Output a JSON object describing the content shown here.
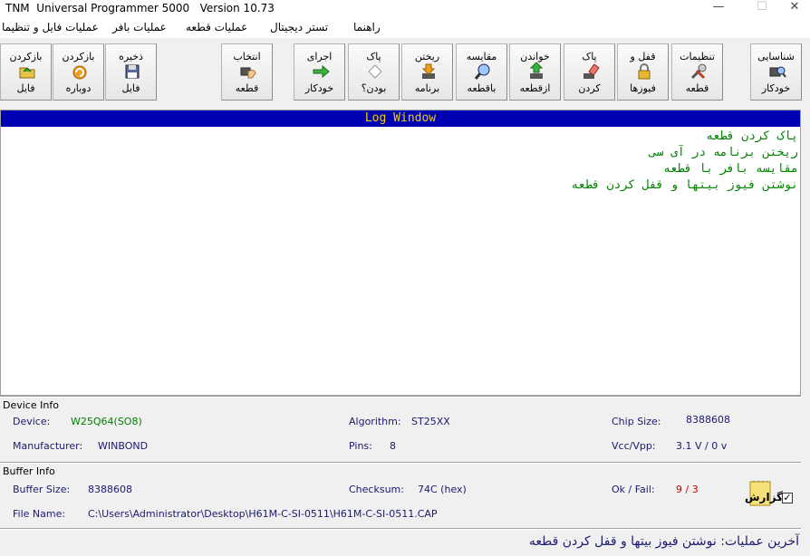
{
  "window": {
    "title": "TNM  Universal Programmer 5000   Version 10.73",
    "minimize": "—",
    "maximize": "☐",
    "close": "✕"
  },
  "menu": [
    "عملیات فایل و تنظیما",
    "عملیات بافر",
    "عملیات قطعه",
    "تستر دیجیتال",
    "راهنما"
  ],
  "toolbar": {
    "load_file": [
      "بازکردن",
      "فایل"
    ],
    "reload": [
      "بازکردن",
      "دوباره"
    ],
    "save_file": [
      "ذخیره",
      "فایل"
    ],
    "select_device": [
      "انتخاب",
      "قطعه"
    ],
    "auto_program": [
      "اجرای",
      "خودکار"
    ],
    "blank_check": [
      "پاک",
      "بودن؟"
    ],
    "program": [
      "ریختن",
      "برنامه"
    ],
    "verify": [
      "مقایسه",
      "باقطعه"
    ],
    "read": [
      "خواندن",
      "ازقطعه"
    ],
    "erase": [
      "پاک",
      "کردن"
    ],
    "lock_fuses": [
      "قفل و",
      "فیوزها"
    ],
    "device_settings": [
      "تنظیمات",
      "قطعه"
    ],
    "auto_detect": [
      "شناسایی",
      "خودکار"
    ]
  },
  "log": {
    "header": "Log Window",
    "lines": [
      "پاک کردن قطعه",
      "ریختن برنامه در آی سی",
      "مقایسه بافر با قطعه",
      "نوشتن فیوز بیتها و قفل کردن قطعه"
    ]
  },
  "device_info": {
    "group_title": "Device Info",
    "device_label": "Device:",
    "device_value": "W25Q64(SO8)",
    "algorithm_label": "Algorithm:",
    "algorithm_value": "ST25XX",
    "chip_size_label": "Chip Size:",
    "chip_size_value": "8388608",
    "manufacturer_label": "Manufacturer:",
    "manufacturer_value": "WINBOND",
    "pins_label": "Pins:",
    "pins_value": "8",
    "vcc_label": "Vcc/Vpp:",
    "vcc_value": "3.1 V / 0 v"
  },
  "buffer_info": {
    "group_title": "Buffer Info",
    "buffer_size_label": "Buffer Size:",
    "buffer_size_value": "8388608",
    "checksum_label": "Checksum:",
    "checksum_value": "74C (hex)",
    "okfail_label": "Ok / Fail:",
    "okfail_value": "9 / 3",
    "filename_label": "File Name:",
    "filename_value": "C:\\Users\\Administrator\\Desktop\\H61M-C-SI-0511\\H61M-C-SI-0511.CAP"
  },
  "report": {
    "label": "گزارش",
    "checked": "✓"
  },
  "status": {
    "label": "آخرین عملیات:",
    "value": "نوشتن فیوز بیتها و قفل کردن قطعه"
  },
  "colors": {
    "log_header_bg": "#0000b3",
    "log_header_text": "#f2d000",
    "log_text": "#008000",
    "device_green": "#008000",
    "fail_red": "#cc0000",
    "label_blue": "#1a1a6e"
  }
}
